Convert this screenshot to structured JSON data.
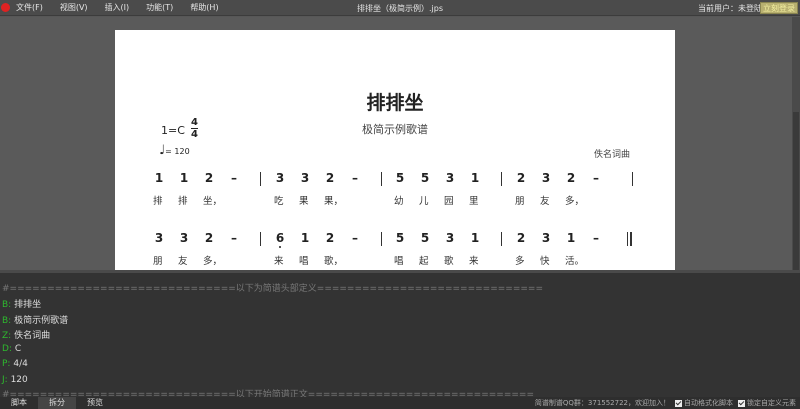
{
  "menubar": {
    "items": [
      "文件(F)",
      "视图(V)",
      "插入(I)",
      "功能(T)",
      "帮助(H)"
    ],
    "window_title": "排排坐（极简示例）.jps",
    "user_label": "当前用户：未登陆",
    "login_button": "立刻登录"
  },
  "score": {
    "title": "排排坐",
    "subtitle": "极简示例歌谱",
    "key": "1=C",
    "time_top": "4",
    "time_bottom": "4",
    "tempo_symbol": "♩",
    "tempo": "= 120",
    "composer": "佚名词曲",
    "rows": [
      {
        "measures": [
          {
            "notes": [
              "1",
              "1",
              "2",
              "–"
            ],
            "low": [],
            "lyrics": [
              "排",
              "排",
              "坐，"
            ]
          },
          {
            "notes": [
              "3",
              "3",
              "2",
              "–"
            ],
            "low": [],
            "lyrics": [
              "吃",
              "果",
              "果，"
            ]
          },
          {
            "notes": [
              "5",
              "5",
              "3",
              "1"
            ],
            "low": [],
            "lyrics": [
              "幼",
              "儿",
              "园",
              "里"
            ]
          },
          {
            "notes": [
              "2",
              "3",
              "2",
              "–"
            ],
            "low": [],
            "lyrics": [
              "朋",
              "友",
              "多，"
            ]
          }
        ],
        "end": "single"
      },
      {
        "measures": [
          {
            "notes": [
              "3",
              "3",
              "2",
              "–"
            ],
            "low": [],
            "lyrics": [
              "朋",
              "友",
              "多，"
            ]
          },
          {
            "notes": [
              "6",
              "1",
              "2",
              "–"
            ],
            "low": [
              0
            ],
            "lyrics": [
              "来",
              "唱",
              "歌，"
            ]
          },
          {
            "notes": [
              "5",
              "5",
              "3",
              "1"
            ],
            "low": [],
            "lyrics": [
              "唱",
              "起",
              "歌",
              "来"
            ]
          },
          {
            "notes": [
              "2",
              "3",
              "1",
              "–"
            ],
            "low": [],
            "lyrics": [
              "多",
              "快",
              "活。"
            ]
          }
        ],
        "end": "final"
      }
    ]
  },
  "editor": {
    "header_comment": "#==============================以下为简谱头部定义==============================",
    "lines": [
      {
        "k": "B:",
        "v": "排排坐"
      },
      {
        "k": "B:",
        "v": "极简示例歌谱"
      },
      {
        "k": "Z:",
        "v": "佚名词曲"
      },
      {
        "k": "D:",
        "v": "C"
      },
      {
        "k": "P:",
        "v": "4/4"
      },
      {
        "k": "J:",
        "v": "120"
      }
    ],
    "body_comment": "#==============================以下开始简谱正文=============================="
  },
  "bottombar": {
    "tabs": [
      "脚本",
      "拆分",
      "预览"
    ],
    "active_tab": 1,
    "qq_text": "简谱制谱QQ群：371552722，欢迎加入！",
    "auto_format_label": "自动格式化脚本",
    "lock_custom_label": "锁定自定义元素"
  }
}
